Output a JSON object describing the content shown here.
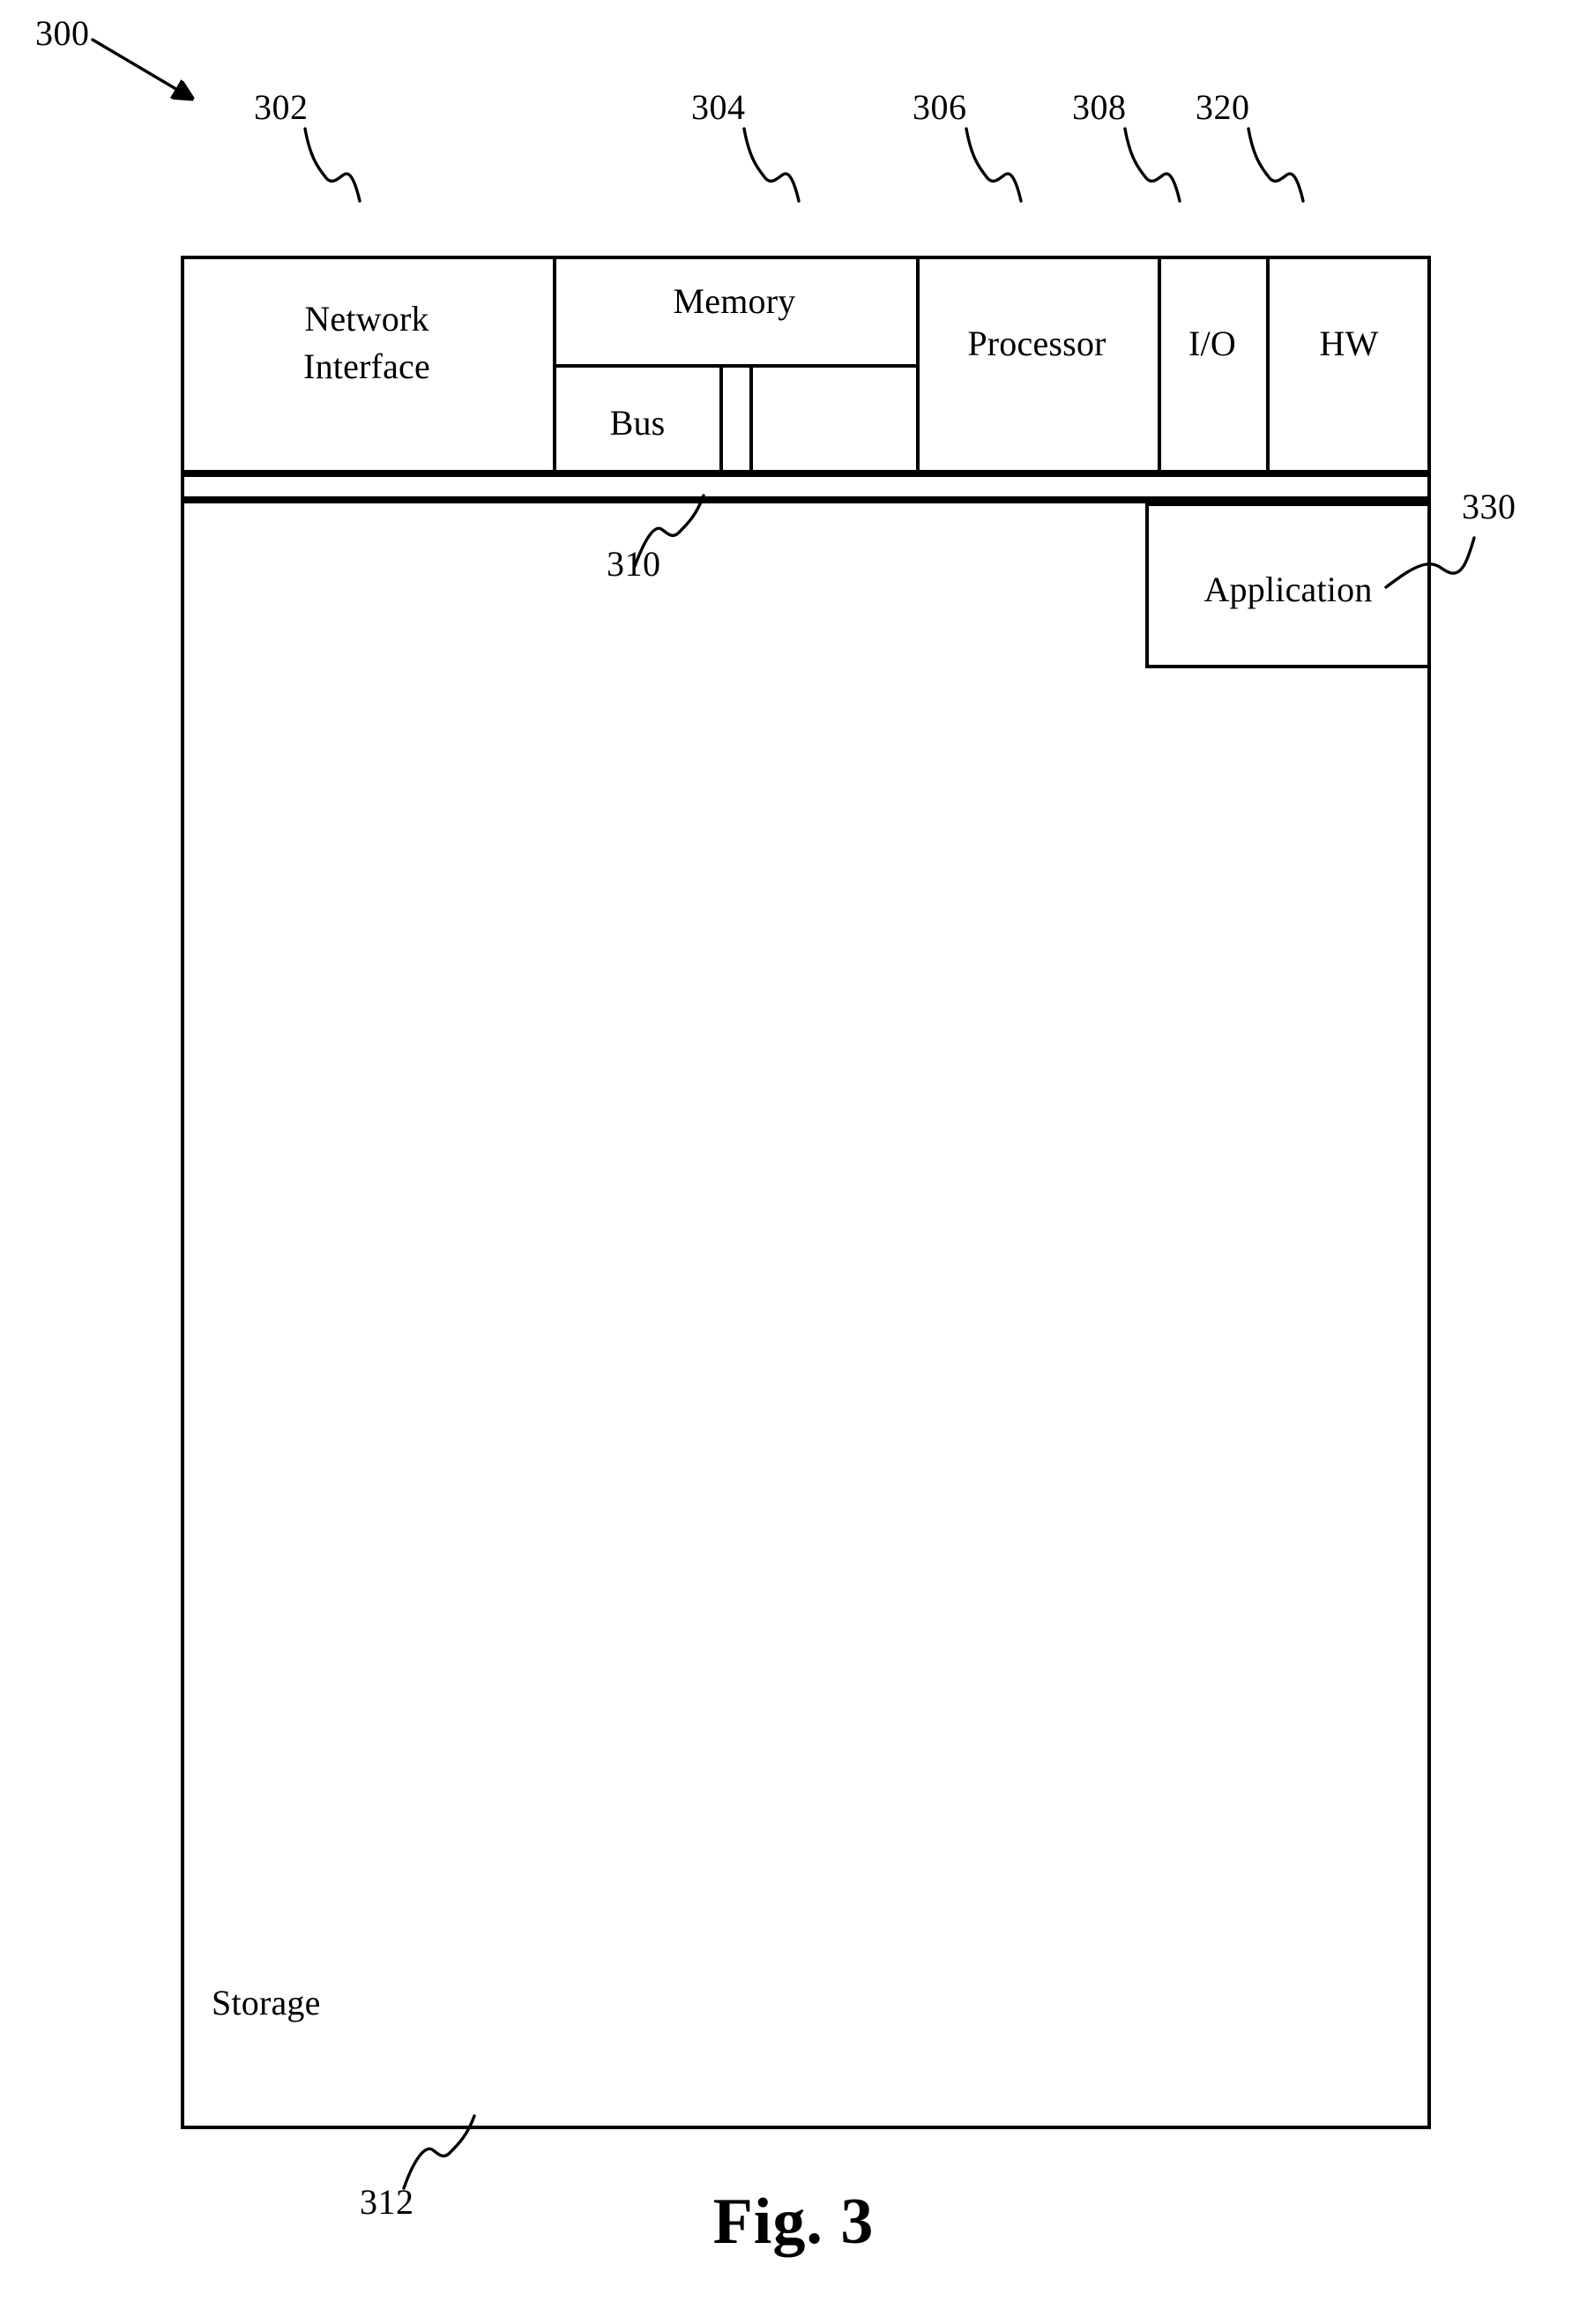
{
  "figure": {
    "caption": "Fig. 3",
    "system_ref": "300"
  },
  "system": {
    "components": [
      {
        "id": "network-interface",
        "label": "Network\nInterface",
        "ref": "302"
      },
      {
        "id": "memory",
        "label": "Memory",
        "ref": "304"
      },
      {
        "id": "bus",
        "label": "Bus",
        "ref": ""
      },
      {
        "id": "processor",
        "label": "Processor",
        "ref": "306"
      },
      {
        "id": "io",
        "label": "I/O",
        "ref": "308"
      },
      {
        "id": "hw",
        "label": "HW",
        "ref": "320"
      }
    ],
    "os_layer": {
      "id": "os-layer",
      "label": "",
      "ref": "310"
    },
    "storage": {
      "id": "storage",
      "label": "Storage",
      "ref": "312"
    },
    "application": {
      "id": "application",
      "label": "Application",
      "ref": "330"
    }
  },
  "labels": {
    "network_interface_line1": "Network",
    "network_interface_line2": "Interface",
    "memory": "Memory",
    "bus": "Bus",
    "processor": "Processor",
    "io": "I/O",
    "hw": "HW",
    "storage": "Storage",
    "application": "Application"
  },
  "refs": {
    "system": "300",
    "network_interface": "302",
    "memory": "304",
    "processor": "306",
    "io": "308",
    "hw": "320",
    "os_layer": "310",
    "storage": "312",
    "application": "330"
  },
  "colors": {
    "stroke": "#000000",
    "background": "#ffffff"
  }
}
